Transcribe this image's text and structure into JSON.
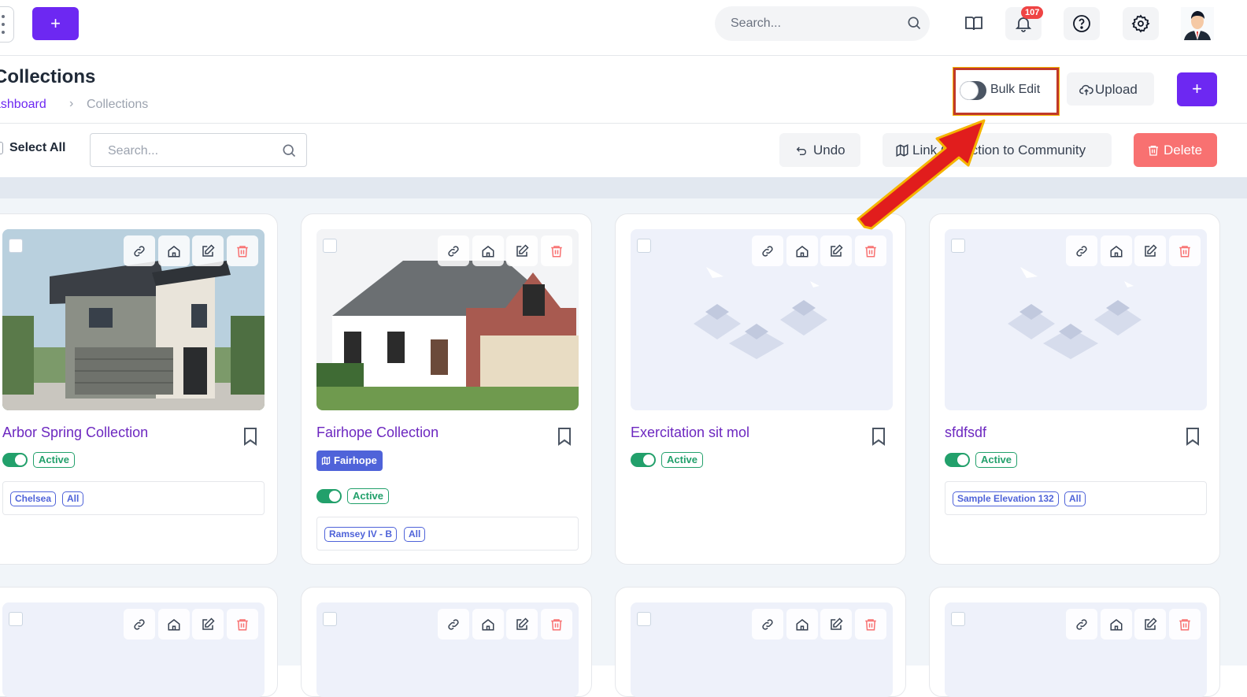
{
  "topbar": {
    "search_placeholder": "Search...",
    "notification_count": "107"
  },
  "header": {
    "title": "Collections",
    "breadcrumb": [
      "ashboard",
      "Collections"
    ],
    "breadcrumb_separator": "›",
    "bulk_edit_label": "Bulk Edit",
    "upload_label": "Upload",
    "add_label": "+"
  },
  "toolbar": {
    "select_all_label": "Select All",
    "search_placeholder": "Search...",
    "undo_label": "Undo",
    "link_label": "Link Collection to Community",
    "delete_label": "Delete"
  },
  "cards": [
    {
      "name": "Arbor Spring Collection",
      "status": "Active",
      "community": "",
      "elevations": [
        "Chelsea",
        "All"
      ],
      "image": "house-modern"
    },
    {
      "name": "Fairhope Collection",
      "status": "Active",
      "community": "Fairhope",
      "elevations": [
        "Ramsey IV - B",
        "All"
      ],
      "image": "house-brick"
    },
    {
      "name": "Exercitation sit mol",
      "status": "Active",
      "community": "",
      "elevations": [],
      "image": "placeholder"
    },
    {
      "name": "sfdfsdf",
      "status": "Active",
      "community": "",
      "elevations": [
        "Sample Elevation 132",
        "All"
      ],
      "image": "placeholder"
    }
  ],
  "colors": {
    "primary": "#6d28f2",
    "active_green": "#22a06b",
    "chip_blue": "#4f63d9",
    "delete_red": "#f87171"
  }
}
